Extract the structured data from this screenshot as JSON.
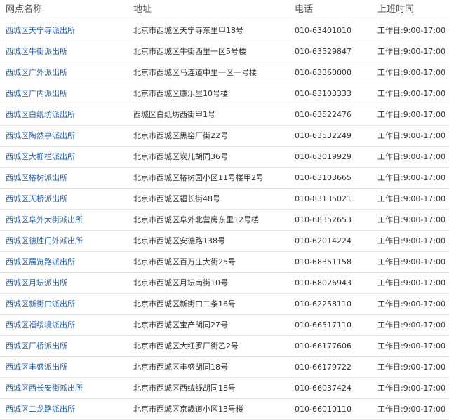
{
  "header": {
    "name": "网点名称",
    "address": "地址",
    "phone": "电话",
    "hours": "上班时间"
  },
  "rows": [
    {
      "name": "西城区天宁寺派出所",
      "address": "北京市西城区天宁寺东里甲18号",
      "phone": "010-63401010",
      "hours": "工作日:9:00-17:00"
    },
    {
      "name": "西城区牛街派出所",
      "address": "北京市西城区牛街西里一区5号楼",
      "phone": "010-63529847",
      "hours": "工作日:9:00-17:00"
    },
    {
      "name": "西城区广外派出所",
      "address": "北京市西城区马连道中里一区一号楼",
      "phone": "010-63360000",
      "hours": "工作日:9:00-17:00"
    },
    {
      "name": "西城区广内派出所",
      "address": "北京市西城区康乐里10号楼",
      "phone": "010-83103333",
      "hours": "工作日:9:00-17:00"
    },
    {
      "name": "西城区白纸坊派出所",
      "address": "西城区白纸坊西街甲1号",
      "phone": "010-63522476",
      "hours": "工作日:9:00-17:00"
    },
    {
      "name": "西城区陶然亭派出所",
      "address": "北京市西城区黑窑厂街22号",
      "phone": "010-63532249",
      "hours": "工作日:9:00-17:00"
    },
    {
      "name": "西城区大栅栏派出所",
      "address": "北京市西城区炭儿胡同36号",
      "phone": "010-63019929",
      "hours": "工作日:9:00-17:00"
    },
    {
      "name": "西城区椿树派出所",
      "address": "北京市西城区椿树园小区11号楼甲2号",
      "phone": "010-63103665",
      "hours": "工作日:9:00-17:00"
    },
    {
      "name": "西城区天桥派出所",
      "address": "北京市西城区福长街48号",
      "phone": "010-83135021",
      "hours": "工作日:9:00-17:00"
    },
    {
      "name": "西城区阜外大街派出所",
      "address": "北京市西城区阜外北营房东里12号楼",
      "phone": "010-68352653",
      "hours": "工作日:9:00-17:00"
    },
    {
      "name": "西城区德胜门外派出所",
      "address": "北京市西城区安德路138号",
      "phone": "010-62014224",
      "hours": "工作日:9:00-17:00"
    },
    {
      "name": "西城区展览路派出所",
      "address": "北京市西城区百万庄大街25号",
      "phone": "010-68351158",
      "hours": "工作日:9:00-17:00"
    },
    {
      "name": "西城区月坛派出所",
      "address": "北京市西城区月坛南街10号",
      "phone": "010-68026943",
      "hours": "工作日:9:00-17:00"
    },
    {
      "name": "西城区新街口派出所",
      "address": "北京市西城区新街口二条16号",
      "phone": "010-62258110",
      "hours": "工作日:9:00-17:00"
    },
    {
      "name": "西城区福绥境派出所",
      "address": "北京市西城区宝产胡同27号",
      "phone": "010-66517110",
      "hours": "工作日:9:00-17:00"
    },
    {
      "name": "西城区厂桥派出所",
      "address": "北京市西城区大红罗厂街乙2号",
      "phone": "010-66177606",
      "hours": "工作日:9:00-17:00"
    },
    {
      "name": "西城区丰盛派出所",
      "address": "北京市西城区丰盛胡同18号",
      "phone": "010-66179722",
      "hours": "工作日:9:00-17:00"
    },
    {
      "name": "西城区西长安街派出所",
      "address": "北京市西城区西绒线胡同18号",
      "phone": "010-66037424",
      "hours": "工作日:9:00-17:00"
    },
    {
      "name": "西城区二龙路派出所",
      "address": "北京市西城区京畿道小区13号楼",
      "phone": "010-66010110",
      "hours": "工作日:9:00-17:00"
    }
  ]
}
